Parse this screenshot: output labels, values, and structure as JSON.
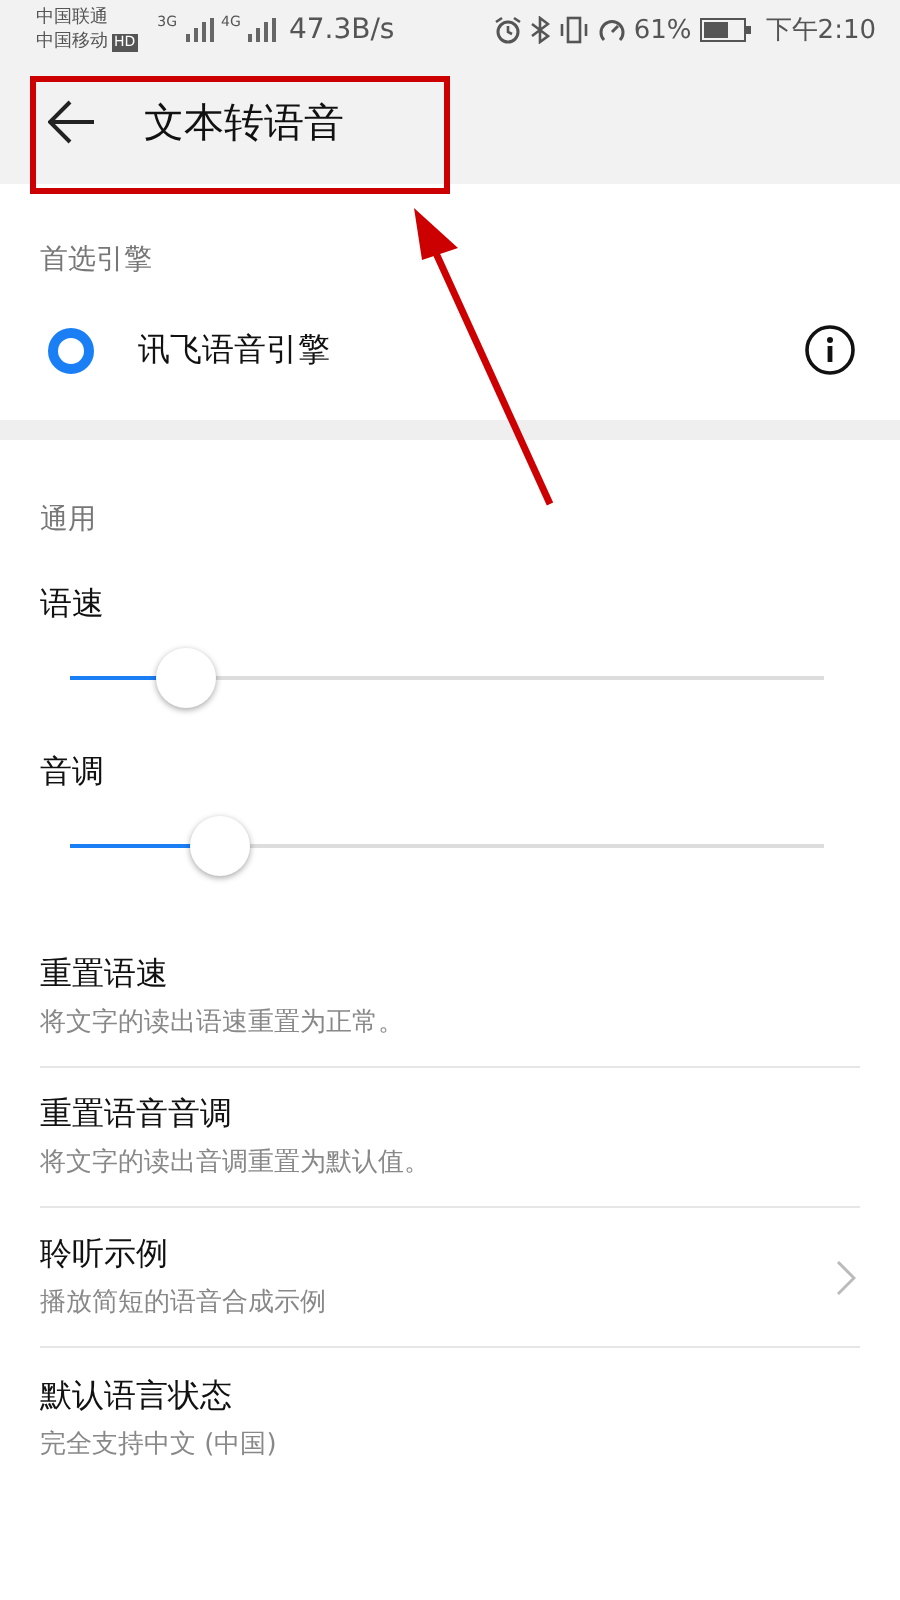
{
  "status_bar": {
    "carrier_1": "中国联通",
    "carrier_2": "中国移动",
    "hd_badge": "HD",
    "network_1": "3G",
    "network_2": "4G",
    "speed": "47.3B/s",
    "battery": "61%",
    "time": "下午2:10"
  },
  "header": {
    "title": "文本转语音"
  },
  "engine_section": {
    "title": "首选引擎",
    "engines": [
      {
        "label": "讯飞语音引擎",
        "selected": true
      }
    ]
  },
  "general_section": {
    "title": "通用",
    "sliders": [
      {
        "label": "语速",
        "level": 0.155
      },
      {
        "label": "音调",
        "level": 0.2
      }
    ],
    "items": [
      {
        "title": "重置语速",
        "subtitle": "将文字的读出语速重置为正常。",
        "chevron": false
      },
      {
        "title": "重置语音音调",
        "subtitle": "将文字的读出音调重置为默认值。",
        "chevron": false
      },
      {
        "title": "聆听示例",
        "subtitle": "播放简短的语音合成示例",
        "chevron": true
      },
      {
        "title": "默认语言状态",
        "subtitle": "完全支持中文 (中国)",
        "chevron": false
      }
    ]
  },
  "annotation": {
    "highlight_box": true,
    "arrow": true
  }
}
